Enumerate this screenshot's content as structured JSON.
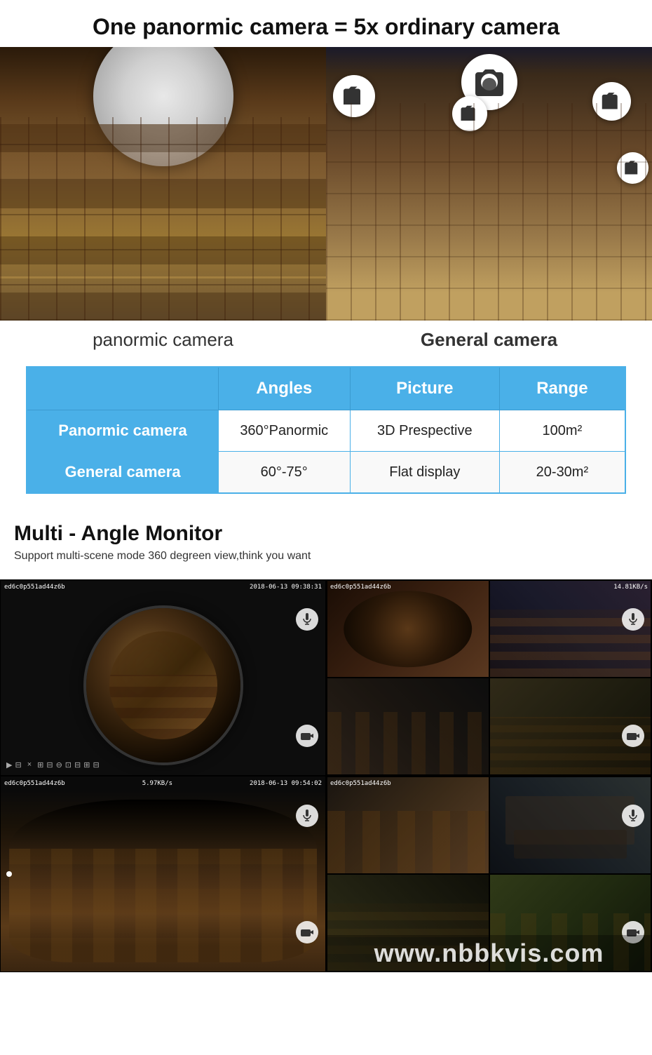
{
  "header": {
    "title": "One panormic camera = 5x ordinary camera"
  },
  "cameras": {
    "panormic_label": "panormic camera",
    "general_label": "General camera"
  },
  "table": {
    "headers": [
      "",
      "Angles",
      "Picture",
      "Range"
    ],
    "rows": [
      {
        "label": "Panormic camera",
        "angles": "360°Panormic",
        "picture": "3D Prespective",
        "range": "100m²"
      },
      {
        "label": "General camera",
        "angles": "60°-75°",
        "picture": "Flat display",
        "range": "20-30m²"
      }
    ]
  },
  "multi_angle": {
    "title": "Multi - Angle Monitor",
    "subtitle": "Support multi-scene mode 360 degreen view,think you want"
  },
  "monitor_feeds": [
    {
      "device_id": "ed6c0p551ad44z6b",
      "timestamp": "2018-06-13 09:38:31",
      "speed": "",
      "type": "fisheye_single"
    },
    {
      "device_id": "ed6c0p551ad44z6b",
      "timestamp": "",
      "speed": "14.81KB/s",
      "type": "quad_split"
    },
    {
      "device_id": "ed6c0p551ad44z6b",
      "timestamp": "2018-06-13 09:54:02",
      "speed": "5.97KB/s",
      "type": "fisheye_flat"
    },
    {
      "device_id": "ed6c0p551ad44z6b",
      "timestamp": "",
      "speed": "",
      "type": "quad_office"
    }
  ],
  "watermark": "www.nbbkvis.com",
  "icons": {
    "camera_icon": "📷",
    "microphone_icon": "🎤",
    "record_icon": "⏺"
  }
}
